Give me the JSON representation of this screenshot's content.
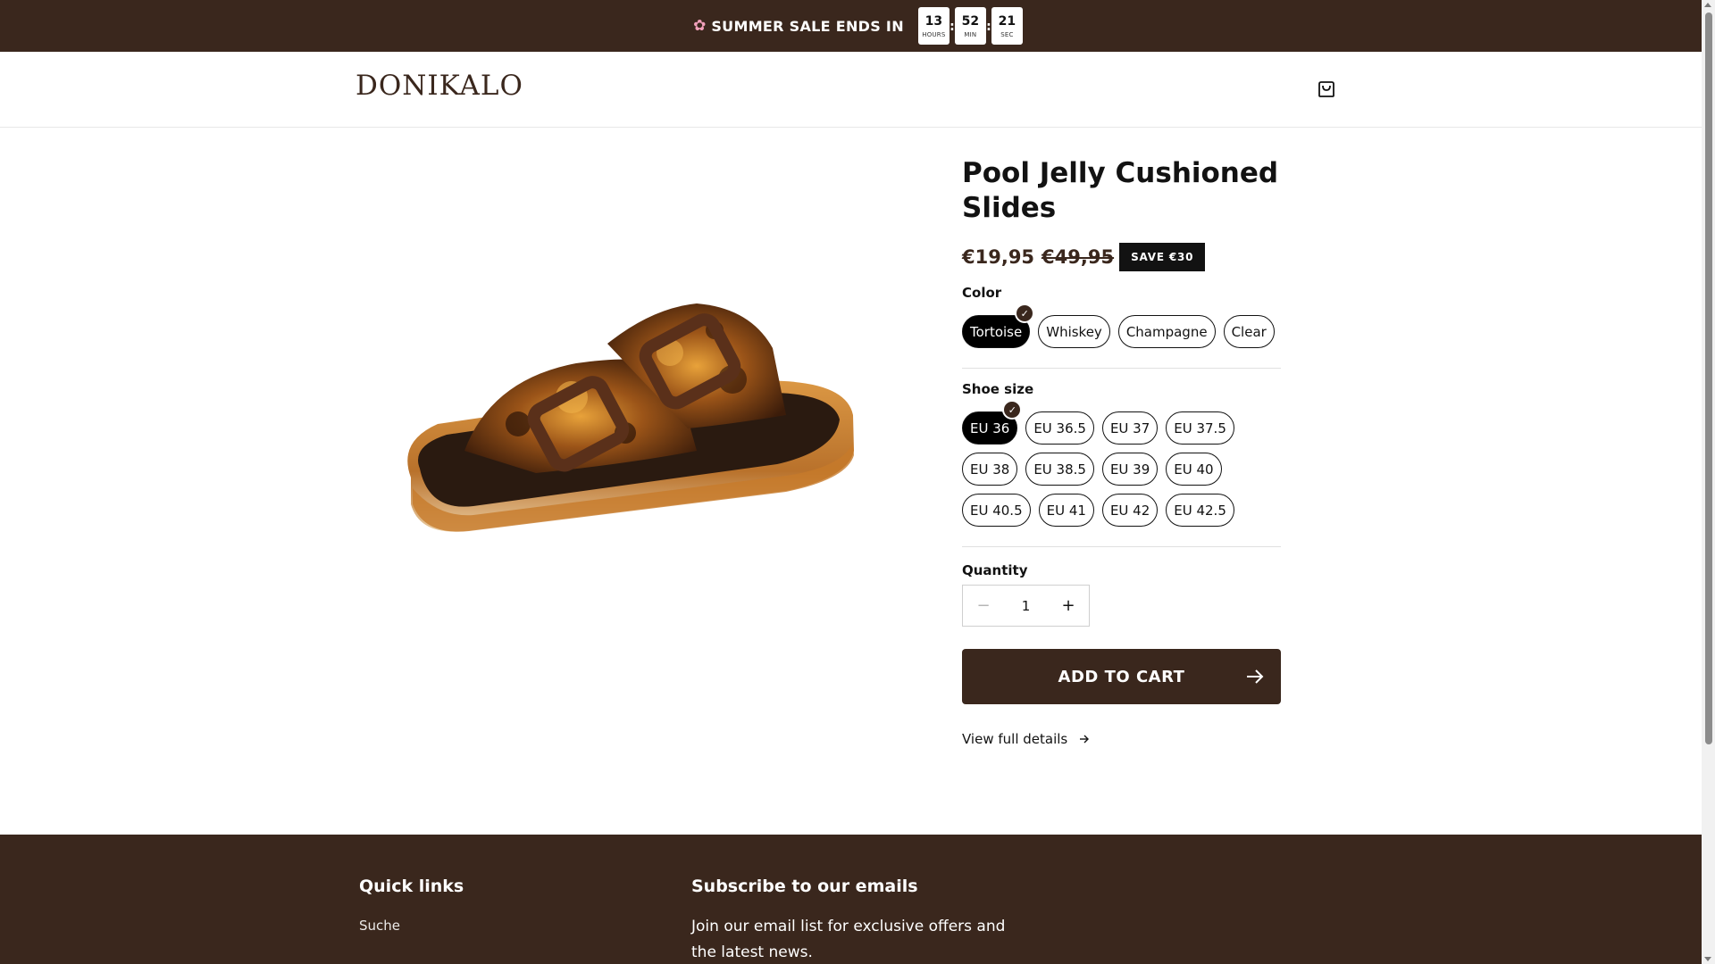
{
  "announcement": {
    "icon": "flower-icon",
    "text": "SUMMER SALE ENDS IN",
    "timer": [
      {
        "value": "13",
        "unit": "HOURS"
      },
      {
        "value": "52",
        "unit": "MIN"
      },
      {
        "value": "21",
        "unit": "SEC"
      }
    ],
    "separator": ":"
  },
  "header": {
    "logo": "DONIKALO",
    "cart_icon": "shopping-bag-icon"
  },
  "product": {
    "image_alt": "Tortoise jelly slide sandal",
    "title": "Pool Jelly Cushioned Slides",
    "price_sale": "€19,95",
    "price_regular": "€49,95",
    "badge": "SAVE €30",
    "color": {
      "label": "Color",
      "options": [
        "Tortoise",
        "Whiskey",
        "Champagne",
        "Clear"
      ],
      "selected": "Tortoise"
    },
    "size": {
      "label": "Shoe size",
      "options": [
        "EU 36",
        "EU 36.5",
        "EU 37",
        "EU 37.5",
        "EU 38",
        "EU 38.5",
        "EU 39",
        "EU 40",
        "EU 40.5",
        "EU 41",
        "EU 42",
        "EU 42.5"
      ],
      "selected": "EU 36"
    },
    "quantity": {
      "label": "Quantity",
      "value": "1",
      "minus": "−",
      "plus": "+"
    },
    "add_to_cart": "ADD TO CART",
    "view_details": "View full details",
    "check_glyph": "✓"
  },
  "footer": {
    "quick_links": {
      "heading": "Quick links",
      "links": [
        "Suche"
      ]
    },
    "subscribe": {
      "heading": "Subscribe to our emails",
      "text": "Join our email list for exclusive offers and the latest news."
    }
  },
  "colors": {
    "brand": "#3a271d",
    "announce_bg": "#3a271d",
    "selected_pill": "#000000"
  }
}
